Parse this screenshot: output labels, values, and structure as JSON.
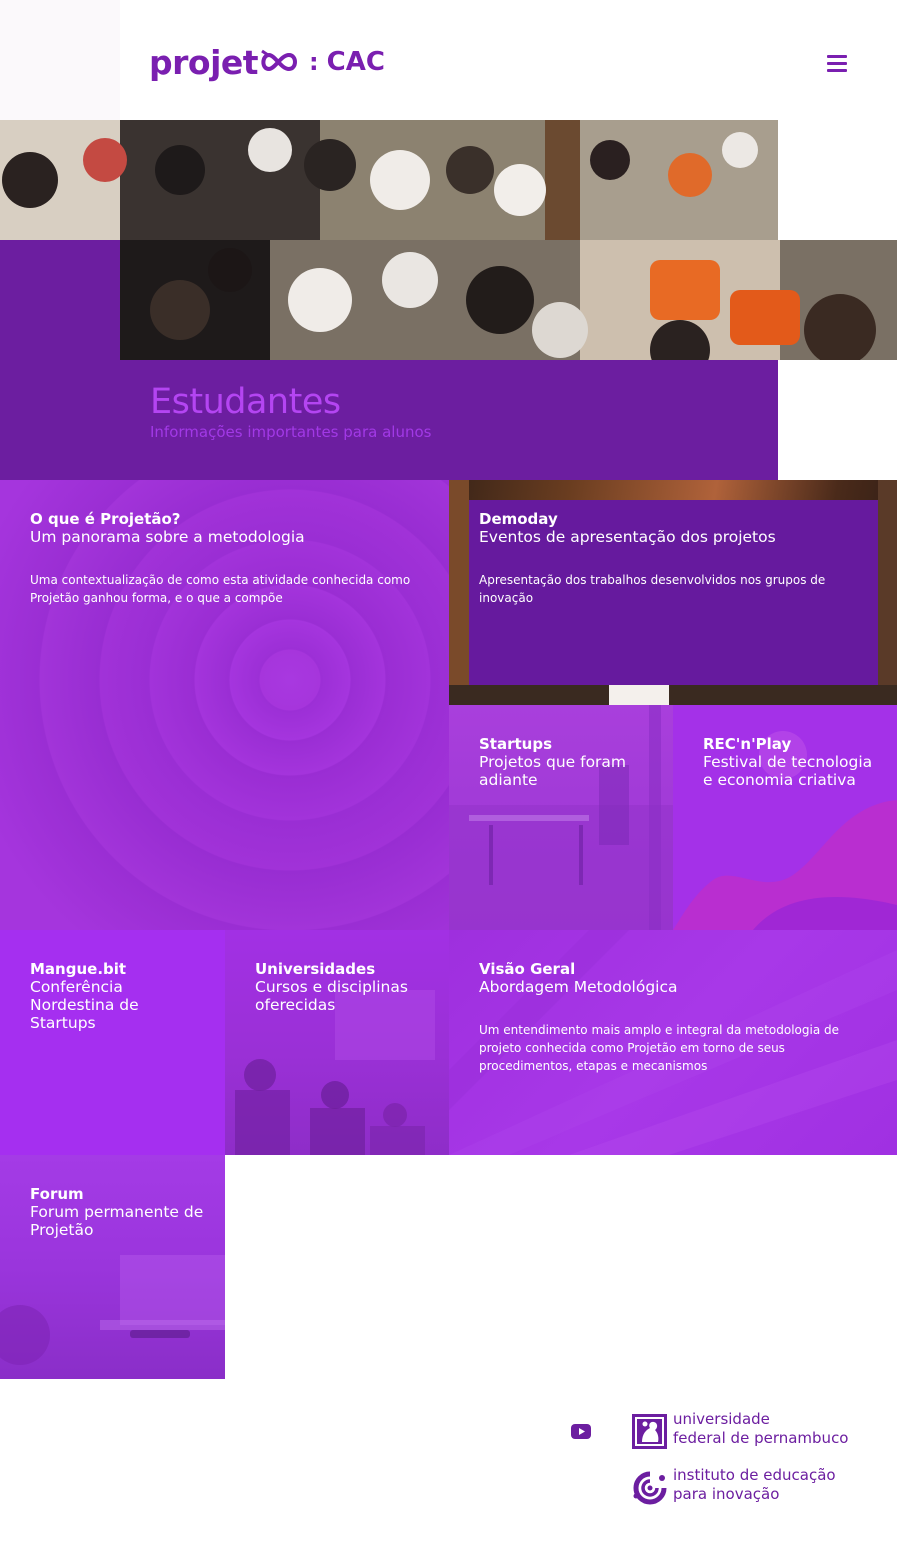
{
  "header": {
    "logo_word": "projet",
    "logo_separator": ":",
    "logo_suffix": "CAC",
    "menu_icon": "hamburger-menu-icon",
    "brand_color": "#7a1fb0"
  },
  "hero": {
    "title": "Estudantes",
    "subtitle": "Informações importantes para alunos",
    "accent_color": "#6c1ea0"
  },
  "tiles": [
    {
      "title": "O que é Projetão?",
      "subtitle": "Um panorama sobre a metodologia",
      "description": "Uma contextualização de como esta atividade conhecida como Projetão ganhou forma, e o que a compõe"
    },
    {
      "title": "Demoday",
      "subtitle": "Eventos de apresentação dos projetos",
      "description": "Apresentação dos trabalhos desenvolvidos nos grupos de inovação"
    },
    {
      "title": "Startups",
      "subtitle": "Projetos que foram adiante"
    },
    {
      "title": "REC'n'Play",
      "subtitle": "Festival de tecnologia e economia criativa"
    },
    {
      "title": "Mangue.bit",
      "subtitle": "Conferência Nordestina de Startups"
    },
    {
      "title": "Universidades",
      "subtitle": "Cursos e disciplinas oferecidas"
    },
    {
      "title": "Visão Geral",
      "subtitle": "Abordagem Metodológica",
      "description": "Um entendimento mais amplo e integral da metodologia de projeto conhecida como Projetão em torno de seus procedimentos, etapas e mecanismos"
    },
    {
      "title": "Forum",
      "subtitle": "Forum permanente de Projetão"
    }
  ],
  "footer": {
    "youtube_icon": "youtube-icon",
    "ufpe_line1": "universidade",
    "ufpe_line2": "federal de pernambuco",
    "iei_line1": "instituto de educação",
    "iei_line2": "para inovação",
    "text_color": "#6c1ea0"
  }
}
